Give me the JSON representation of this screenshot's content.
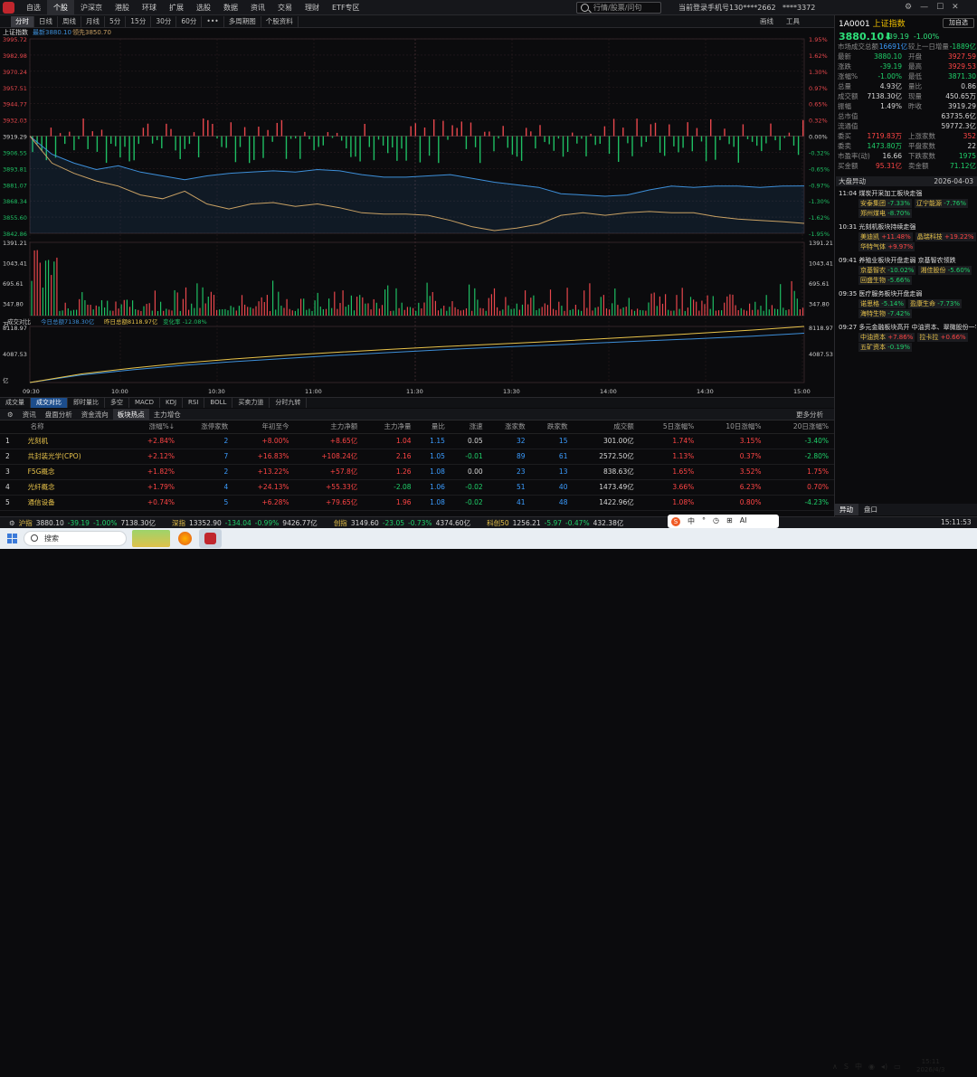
{
  "topbar": {
    "menu": [
      "自选",
      "个股",
      "沪深京",
      "港股",
      "环球",
      "扩展",
      "选股",
      "数据",
      "资讯",
      "交易",
      "理财",
      "ETF专区"
    ],
    "active": "个股",
    "search_placeholder": "行情/股票/问句",
    "login_info": "当前登录手机号130****2662",
    "user": "****3372"
  },
  "toolbar": {
    "tabs": [
      "分时",
      "日线",
      "周线",
      "月线",
      "5分",
      "15分",
      "30分",
      "60分",
      "•••",
      "多周期图",
      "个股资料"
    ],
    "active": "分时",
    "right": [
      "画线",
      "工具"
    ]
  },
  "chart": {
    "title": "上证指数",
    "latest_label": "最新",
    "latest": "3880.10",
    "lead_label": "领先",
    "lead": "3850.70",
    "y_left": [
      "3995.72",
      "3982.98",
      "3970.24",
      "3957.51",
      "3944.77",
      "3932.03",
      "3919.29",
      "3906.55",
      "3893.81",
      "3881.07",
      "3868.34",
      "3855.60",
      "3842.86"
    ],
    "y_right": [
      "1.95%",
      "1.62%",
      "1.30%",
      "0.97%",
      "0.65%",
      "0.32%",
      "0.00%",
      "-0.32%",
      "-0.65%",
      "-0.97%",
      "-1.30%",
      "-1.62%",
      "-1.95%"
    ],
    "vol_labels": [
      "1391.21",
      "1043.41",
      "695.61",
      "347.80",
      "万"
    ],
    "cmp_title": "成交对比",
    "cmp_today_label": "今日总额",
    "cmp_today": "7138.30亿",
    "cmp_prev_label": "昨日总额",
    "cmp_prev": "8118.97亿",
    "cmp_change_label": "变化率",
    "cmp_change": "-12.08%",
    "cmp_y": [
      "8118.97",
      "4087.53",
      "亿"
    ],
    "time_ticks": [
      "09:30",
      "10:00",
      "10:30",
      "11:00",
      "11:30",
      "13:30",
      "14:00",
      "14:30",
      "15:00"
    ],
    "colors": {
      "price": "#3d8fd9",
      "lead": "#c9a164",
      "up": "#e8474c",
      "down": "#1fbf63",
      "bg": "#0b0b0d",
      "grid": "#2d1e22"
    }
  },
  "chart_data": [
    {
      "type": "line",
      "title": "上证指数",
      "series": [
        {
          "name": "最新",
          "values": [
            3919.29,
            3905,
            3898,
            3893,
            3896,
            3891,
            3888,
            3885,
            3888,
            3890,
            3891,
            3892,
            3891,
            3893,
            3892,
            3889,
            3887,
            3887,
            3888,
            3889,
            3886,
            3883,
            3881,
            3879,
            3874,
            3873,
            3872,
            3873,
            3877,
            3880,
            3879,
            3880,
            3880,
            3879,
            3880,
            3880.1
          ]
        },
        {
          "name": "领先",
          "values": [
            3919.29,
            3898,
            3890,
            3884,
            3880,
            3873,
            3870,
            3876,
            3866,
            3862,
            3866,
            3867,
            3864,
            3866,
            3863,
            3859,
            3858,
            3858,
            3857,
            3853,
            3848,
            3845,
            3847,
            3850,
            3857,
            3859,
            3857,
            3859,
            3860,
            3859,
            3859,
            3856,
            3854,
            3853,
            3852,
            3850.7
          ]
        }
      ],
      "ylim": [
        3842.86,
        3995.72
      ]
    },
    {
      "type": "line",
      "title": "成交对比",
      "series": [
        {
          "name": "今日总额",
          "values": [
            0,
            1100,
            1850,
            2500,
            3050,
            3500,
            3950,
            4350,
            4750,
            5100,
            5400,
            5720,
            6050,
            6370,
            6700,
            7138.3
          ]
        },
        {
          "name": "昨日总额",
          "values": [
            0,
            1250,
            2100,
            2850,
            3450,
            3950,
            4400,
            4800,
            5200,
            5550,
            5900,
            6300,
            6700,
            7150,
            7600,
            8118.97
          ]
        }
      ],
      "ylim": [
        0,
        8118.97
      ]
    }
  ],
  "tabs_bottom": {
    "items": [
      "成交量",
      "成交对比",
      "即时量比",
      "多空",
      "MACD",
      "KDJ",
      "RSI",
      "BOLL",
      "买卖力道",
      "分时九转"
    ],
    "active": "成交对比"
  },
  "section3": {
    "items": [
      "资讯",
      "盘面分析",
      "资金流向",
      "板块热点",
      "主力增仓"
    ],
    "active": "板块热点",
    "more": "更多分析"
  },
  "table": {
    "headers": [
      "",
      "名称",
      "涨幅%↓",
      "涨停家数",
      "年初至今",
      "主力净额",
      "主力净量",
      "量比",
      "涨速",
      "涨家数",
      "跌家数",
      "成交额",
      "5日涨幅%",
      "10日涨幅%",
      "20日涨幅%"
    ],
    "rows": [
      [
        "1",
        "光刻机",
        "+2.84%",
        "2",
        "+8.00%",
        "+8.65亿",
        "1.04",
        "1.15",
        "0.05",
        "32",
        "15",
        "301.00亿",
        "1.74%",
        "3.15%",
        "-3.40%"
      ],
      [
        "2",
        "共封装光学(CPO)",
        "+2.12%",
        "7",
        "+16.83%",
        "+108.24亿",
        "2.16",
        "1.05",
        "-0.01",
        "89",
        "61",
        "2572.50亿",
        "1.13%",
        "0.37%",
        "-2.80%"
      ],
      [
        "3",
        "F5G概念",
        "+1.82%",
        "2",
        "+13.22%",
        "+57.8亿",
        "1.26",
        "1.08",
        "0.00",
        "23",
        "13",
        "838.63亿",
        "1.65%",
        "3.52%",
        "1.75%"
      ],
      [
        "4",
        "光纤概念",
        "+1.79%",
        "4",
        "+24.13%",
        "+55.33亿",
        "-2.08",
        "1.06",
        "-0.02",
        "51",
        "40",
        "1473.49亿",
        "3.66%",
        "6.23%",
        "0.70%"
      ],
      [
        "5",
        "通信设备",
        "+0.74%",
        "5",
        "+6.28%",
        "+79.65亿",
        "1.96",
        "1.08",
        "-0.02",
        "41",
        "48",
        "1422.96亿",
        "1.08%",
        "0.80%",
        "-4.23%"
      ]
    ]
  },
  "rightpanel": {
    "code": "1A0001",
    "name": "上证指数",
    "add": "加自选",
    "price": "3880.10",
    "arrow": "⬇",
    "change": "-39.19",
    "pct": "-1.00%",
    "overview": [
      [
        "市场成交总额",
        "16691亿",
        "较上一日增量",
        "-1889亿"
      ]
    ],
    "quote": [
      [
        "最新",
        "3880.10",
        "开盘",
        "3927.59"
      ],
      [
        "涨跌",
        "-39.19",
        "最高",
        "3929.53"
      ],
      [
        "涨幅%",
        "-1.00%",
        "最低",
        "3871.30"
      ],
      [
        "总量",
        "4.93亿",
        "量比",
        "0.86"
      ],
      [
        "成交额",
        "7138.30亿",
        "现量",
        "450.65万"
      ],
      [
        "振幅",
        "1.49%",
        "昨收",
        "3919.29"
      ],
      [
        "总市值",
        "",
        "",
        "63735.6亿"
      ],
      [
        "流通值",
        "",
        "",
        "59772.3亿"
      ],
      [
        "委买",
        "1719.83万",
        "上涨家数",
        "352"
      ],
      [
        "委卖",
        "1473.80万",
        "平盘家数",
        "22"
      ],
      [
        "市盈率(动)",
        "16.66",
        "下跌家数",
        "1975"
      ],
      [
        "买金额",
        "95.31亿",
        "卖金额",
        "71.12亿"
      ]
    ],
    "events_title": "大盘异动",
    "events_date": "2026-04-03",
    "events": [
      {
        "time": "11:04",
        "text": "煤炭开采加工板块走强",
        "stocks": [
          [
            "安泰集团",
            "-7.33%"
          ],
          [
            "辽宁能源",
            "-7.76%"
          ],
          [
            "郑州煤电",
            "-8.70%"
          ]
        ]
      },
      {
        "time": "10:31",
        "text": "光刻机板块持续走强",
        "stocks": [
          [
            "美迪凯",
            "+11.48%"
          ],
          [
            "晶瑞科技",
            "+19.22%"
          ],
          [
            "华特气体",
            "+9.97%"
          ]
        ]
      },
      {
        "time": "09:41",
        "text": "养殖业板块开盘走弱 京基智农领跌",
        "stocks": [
          [
            "京基智农",
            "-10.02%"
          ],
          [
            "湘佳股份",
            "-5.60%"
          ],
          [
            "回盛生物",
            "-5.66%"
          ]
        ]
      },
      {
        "time": "09:35",
        "text": "医疗服务板块开盘走弱",
        "stocks": [
          [
            "诺思格",
            "-5.14%"
          ],
          [
            "盈康生命",
            "-7.73%"
          ],
          [
            "海特生物",
            "-7.42%"
          ]
        ]
      },
      {
        "time": "09:27",
        "text": "多元金融板块高开 中油资本、翠微股份一字",
        "stocks": [
          [
            "中油资本",
            "+7.86%"
          ],
          [
            "拉卡拉",
            "+0.66%"
          ],
          [
            "五矿资本",
            "-0.19%"
          ]
        ]
      }
    ],
    "tabs": [
      "异动",
      "盘口"
    ]
  },
  "statusbar": {
    "items": [
      [
        "沪指",
        "3880.10",
        "-39.19",
        "-1.00%",
        "7138.30亿"
      ],
      [
        "深指",
        "13352.90",
        "-134.04",
        "-0.99%",
        "9426.77亿"
      ],
      [
        "创指",
        "3149.60",
        "-23.05",
        "-0.73%",
        "4374.60亿"
      ],
      [
        "科创50",
        "1256.21",
        "-5.97",
        "-0.47%",
        "432.38亿"
      ]
    ],
    "time": "15:11:53"
  },
  "taskbar": {
    "search": "搜索",
    "clock_time": "15:11",
    "clock_date": "2026/4/3",
    "ime": [
      "中",
      "°",
      "◷",
      "⊞",
      "AI"
    ],
    "tray_lang": "中"
  }
}
